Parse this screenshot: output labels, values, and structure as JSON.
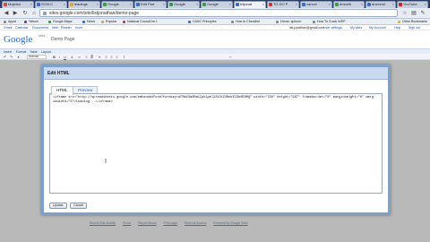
{
  "browser": {
    "tabs": [
      {
        "label": "Mojetsn",
        "color": "#d04a3a"
      },
      {
        "label": "SCM-C",
        "color": "#3a6cc8"
      },
      {
        "label": "leadings",
        "color": "#e8a23a"
      },
      {
        "label": "Google",
        "color": "#3a9a4a"
      },
      {
        "label": "Edit Part",
        "color": "#3a6cc8"
      },
      {
        "label": "Google",
        "color": "#3a9a4a"
      },
      {
        "label": "Google",
        "color": "#3a9a4a"
      },
      {
        "label": "Intjonat",
        "color": "#3a6cc8",
        "active": true
      },
      {
        "label": "TO DO P",
        "color": "#c83a3a"
      },
      {
        "label": "cancer",
        "color": "#3a6cc8"
      },
      {
        "label": "dmnelh",
        "color": "#3a9a4a"
      },
      {
        "label": "dnevxmi",
        "color": "#3a6cc8"
      },
      {
        "label": "YouTube",
        "color": "#d02020"
      }
    ],
    "url": "sites.google.com/site/listjonathan/demo-page",
    "bookmarks": [
      {
        "label": "Apple",
        "color": "#888"
      },
      {
        "label": "Yahoo!",
        "color": "#7a3ab8"
      },
      {
        "label": "Google Maps",
        "color": "#3a9a4a"
      },
      {
        "label": "News",
        "color": "#3a6cc8"
      },
      {
        "label": "Popular",
        "color": "#e8a23a"
      },
      {
        "label": "National Council for t",
        "color": "#c83a3a"
      },
      {
        "label": "CASC Principles",
        "color": "#3a6cc8"
      },
      {
        "label": "How to Checklist",
        "color": "#888"
      },
      {
        "label": "Home: spinner",
        "color": "#888"
      },
      {
        "label": "How To Crack WEP",
        "color": "#888"
      }
    ],
    "other_bookmarks": "Other Bookmarks"
  },
  "gbar": {
    "links": [
      "Gmail",
      "Calendar",
      "Documents",
      "Web",
      "Reader",
      "more"
    ],
    "user": "list.jonathan@gmail.com",
    "right_links": [
      "User settings",
      "My sites",
      "My Account",
      "Help",
      "Sign out"
    ]
  },
  "header": {
    "logo": "Google",
    "sites": "sites",
    "page_title": "Demo Page"
  },
  "menubar": {
    "items": [
      "Insert",
      "Format",
      "Table",
      "Layout"
    ]
  },
  "toolbar": {
    "font": "Normal"
  },
  "dialog": {
    "title": "Edit HTML",
    "tabs": [
      "HTML",
      "Preview"
    ],
    "code": "<iframe src=\"http://spreadsheets.google.com/embeddedform?formkey=dFRmV3a0Rm1Cpb1pel22X21ZVBwVXlDb0E6MQ\" width=\"760\" height=\"987\" frameborder=\"0\" marginheight=\"0\" marginwidth=\"0\">Loading...</iframe>",
    "buttons": [
      "Update",
      "Cancel"
    ]
  },
  "footer": {
    "links": [
      "Recent Site Activity",
      "Terms",
      "Report Abuse",
      "Print page",
      "Remove Access",
      "Powered by Google Sites"
    ]
  }
}
